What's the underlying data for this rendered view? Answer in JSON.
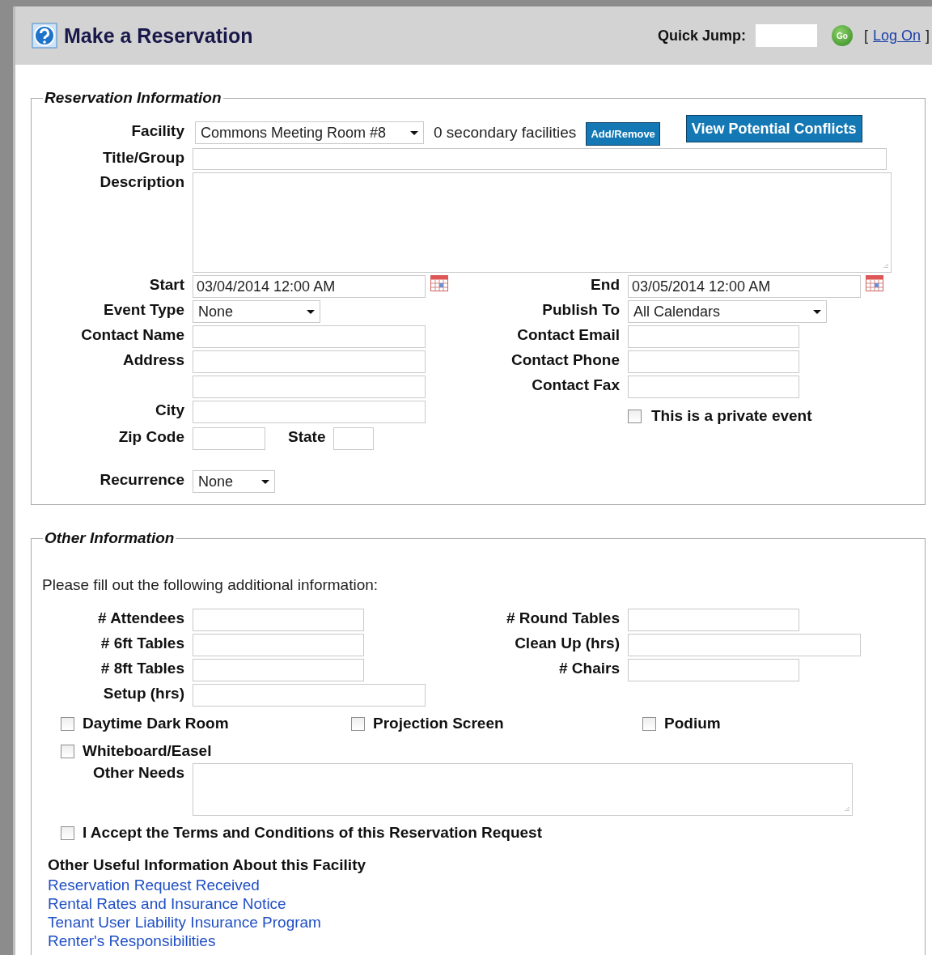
{
  "header": {
    "title": "Make a Reservation",
    "quick_jump": {
      "label": "Quick Jump:"
    },
    "go_button": "Go",
    "log_on": {
      "bracket_open": "[",
      "link": "Log On",
      "bracket_close": "]"
    }
  },
  "reservation_information": {
    "legend": "Reservation Information",
    "facility": {
      "label": "Facility",
      "value": "Commons Meeting Room #8"
    },
    "secondary_facilities": "0 secondary facilities",
    "add_remove_button": "Add/Remove",
    "conflicts_button": "View Potential Conflicts",
    "title_group": {
      "label": "Title/Group"
    },
    "description": {
      "label": "Description"
    },
    "left_fields": [
      {
        "kind": "date",
        "label": "Start",
        "value": "03/04/2014 12:00 AM"
      },
      {
        "kind": "select",
        "label": "Event Type",
        "value": "None"
      },
      {
        "kind": "text",
        "label": "Contact Name"
      },
      {
        "kind": "text",
        "label": "Address"
      },
      {
        "kind": "text"
      },
      {
        "kind": "text",
        "label": "City"
      },
      {
        "kind": "pair",
        "label": "Zip Code",
        "second_label": "State"
      },
      {
        "kind": "select",
        "label": "Recurrence",
        "value": "None"
      }
    ],
    "right_fields": [
      {
        "kind": "date",
        "label": "End",
        "value": "03/05/2014 12:00 AM"
      },
      {
        "kind": "select",
        "label": "Publish To",
        "value": "All Calendars"
      },
      {
        "kind": "text",
        "label": "Contact Email"
      },
      {
        "kind": "text",
        "label": "Contact Phone"
      },
      {
        "kind": "text",
        "label": "Contact Fax"
      },
      {
        "kind": "checkbox",
        "label": "This is a private event",
        "checked": false
      }
    ]
  },
  "other_information": {
    "legend": "Other Information",
    "intro": "Please fill out the following additional information:",
    "left_fields": [
      {
        "label": "# Attendees"
      },
      {
        "label": "# 6ft Tables"
      },
      {
        "label": "# 8ft Tables"
      },
      {
        "label": "Setup (hrs)"
      }
    ],
    "right_fields": [
      {
        "label": "# Round Tables"
      },
      {
        "label": "Clean Up (hrs)"
      },
      {
        "label": "# Chairs"
      }
    ],
    "options": [
      {
        "label": "Daytime Dark Room",
        "checked": false
      },
      {
        "label": "Projection Screen",
        "checked": false
      },
      {
        "label": "Podium",
        "checked": false
      },
      {
        "label": "Whiteboard/Easel",
        "checked": false
      }
    ],
    "other_needs": {
      "label": "Other Needs"
    },
    "terms": {
      "label": "I Accept the Terms and Conditions of this Reservation Request",
      "checked": false
    },
    "useful_info": {
      "heading": "Other Useful Information About this Facility",
      "links": [
        "Reservation Request Received",
        "Rental Rates and Insurance Notice",
        "Tenant User Liability Insurance Program",
        "Renter's Responsibilities"
      ]
    }
  }
}
